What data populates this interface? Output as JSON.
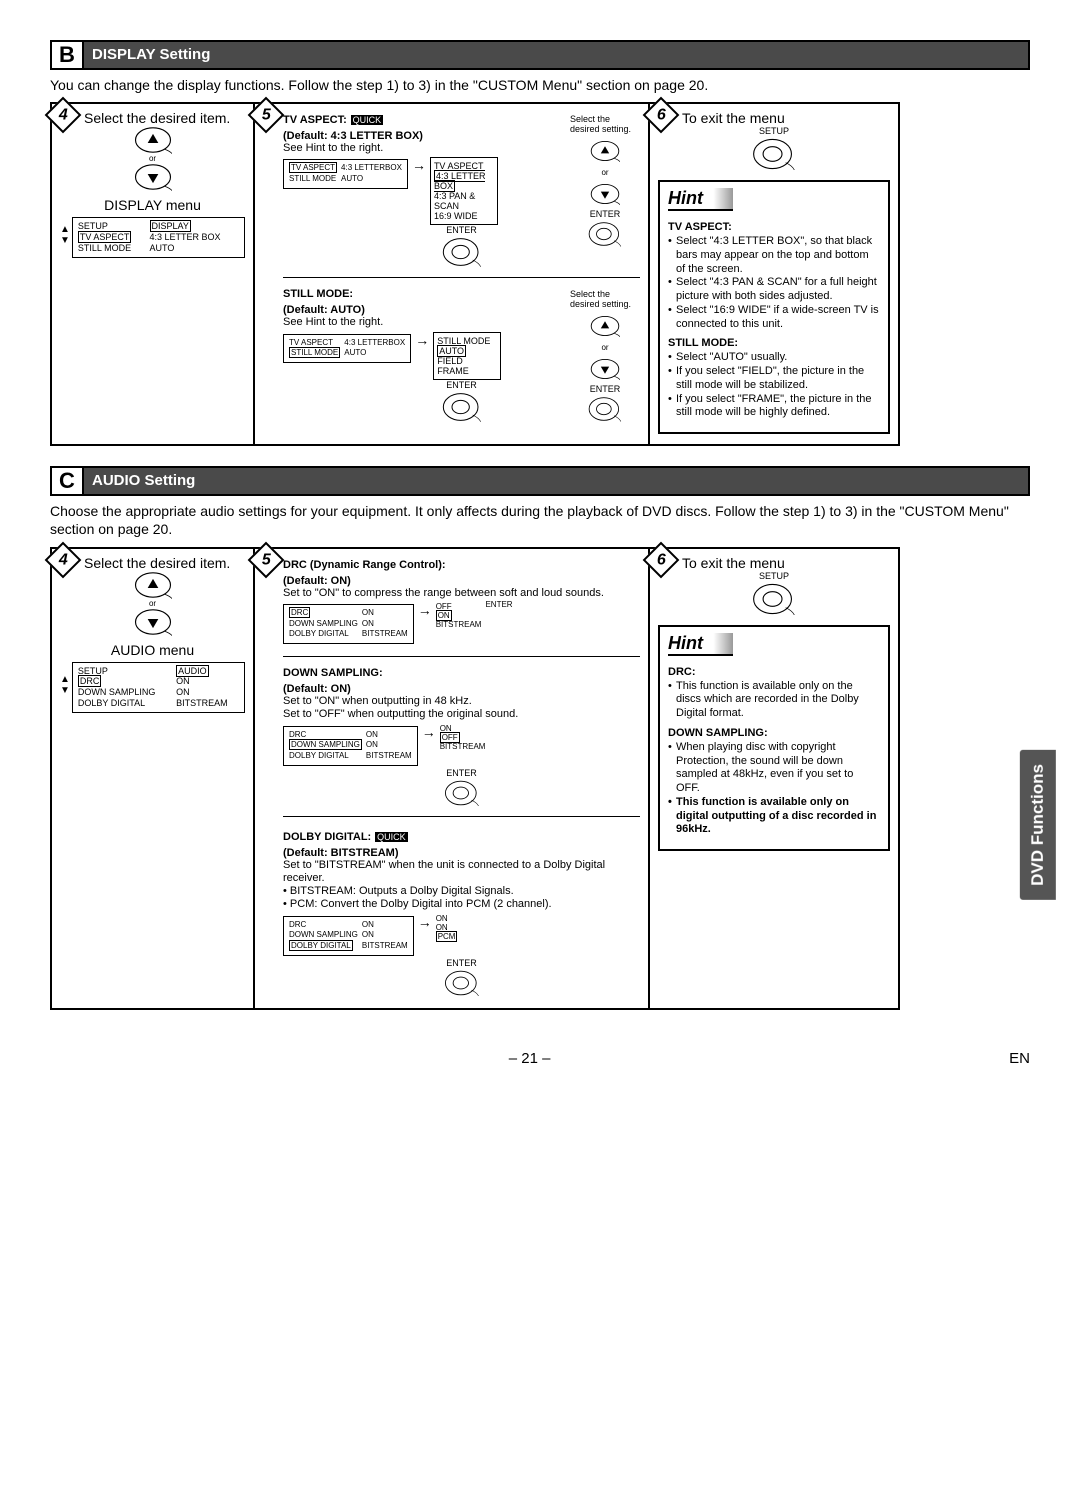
{
  "page_number": "– 21 –",
  "lang_code": "EN",
  "side_tab": "DVD Functions",
  "sectionB": {
    "letter": "B",
    "title": "DISPLAY Setting",
    "intro": "You can change the display functions. Follow the step 1) to 3) in the \"CUSTOM Menu\" section on page 20.",
    "step4": {
      "num": "4",
      "inst": "Select the desired item.",
      "or": "or",
      "menu_title": "DISPLAY menu",
      "screen": {
        "hdr_l": "SETUP",
        "hdr_r": "DISPLAY",
        "r1l": "TV ASPECT",
        "r1r": "4:3 LETTER BOX",
        "r2l": "STILL MODE",
        "r2r": "AUTO"
      }
    },
    "step5": {
      "num": "5",
      "tv": {
        "head": "TV ASPECT:",
        "quick": "QUICK",
        "def": "(Default: 4:3 LETTER BOX)",
        "see": "See Hint to the right.",
        "screen": {
          "r1l": "TV ASPECT",
          "r1r": "4:3 LETTERBOX",
          "r2l": "STILL MODE",
          "r2r": "AUTO"
        },
        "options": {
          "hdr": "TV ASPECT",
          "o1": "4:3 LETTER BOX",
          "o2": "4:3 PAN & SCAN",
          "o3": "16:9 WIDE"
        }
      },
      "still": {
        "head": "STILL MODE:",
        "def": "(Default: AUTO)",
        "see": "See Hint to the right.",
        "screen": {
          "r1l": "TV ASPECT",
          "r1r": "4:3 LETTERBOX",
          "r2l": "STILL MODE",
          "r2r": "AUTO"
        },
        "options": {
          "hdr": "STILL MODE",
          "o1": "AUTO",
          "o2": "FIELD",
          "o3": "FRAME"
        }
      },
      "sel": "Select the desired setting.",
      "enter": "ENTER",
      "or": "or"
    },
    "step6": {
      "num": "6",
      "inst": "To exit the menu",
      "setup": "SETUP",
      "hint_hdr": "Hint",
      "tv_hdr": "TV ASPECT:",
      "tv_items": [
        "Select \"4:3 LETTER BOX\", so that black bars may appear on the top and bottom of the screen.",
        "Select \"4:3 PAN & SCAN\" for a full height picture with both sides adjusted.",
        "Select \"16:9 WIDE\" if a wide-screen TV is connected to this unit."
      ],
      "still_hdr": "STILL MODE:",
      "still_items": [
        "Select \"AUTO\" usually.",
        "If you select \"FIELD\", the picture in the still mode will be stabilized.",
        "If you select \"FRAME\", the picture in the still mode will be highly defined."
      ]
    }
  },
  "sectionC": {
    "letter": "C",
    "title": "AUDIO Setting",
    "intro": "Choose the appropriate audio settings for your equipment. It only affects during the playback of DVD discs. Follow the step 1) to 3) in the \"CUSTOM Menu\" section on page 20.",
    "step4": {
      "num": "4",
      "inst": "Select the desired item.",
      "or": "or",
      "menu_title": "AUDIO menu",
      "screen": {
        "hdr_l": "SETUP",
        "hdr_r": "AUDIO",
        "r1l": "DRC",
        "r1r": "ON",
        "r2l": "DOWN SAMPLING",
        "r2r": "ON",
        "r3l": "DOLBY DIGITAL",
        "r3r": "BITSTREAM"
      }
    },
    "step5": {
      "num": "5",
      "drc": {
        "head": "DRC (Dynamic Range Control):",
        "def": "(Default: ON)",
        "desc": "Set to \"ON\" to compress the range between soft and loud sounds.",
        "screen": {
          "r1l": "DRC",
          "r1r": "ON",
          "r2l": "DOWN SAMPLING",
          "r2r": "ON",
          "r3l": "DOLBY DIGITAL",
          "r3r": "BITSTREAM"
        },
        "opts": {
          "o1": "OFF",
          "o2": "ON",
          "o3": "BITSTREAM"
        }
      },
      "ds": {
        "head": "DOWN SAMPLING:",
        "def": "(Default: ON)",
        "d1": "Set to \"ON\" when outputting in 48 kHz.",
        "d2": "Set to \"OFF\" when outputting the original sound.",
        "screen": {
          "r1l": "DRC",
          "r1r": "ON",
          "r2l": "DOWN SAMPLING",
          "r2r": "ON",
          "r3l": "DOLBY DIGITAL",
          "r3r": "BITSTREAM"
        },
        "opts": {
          "o1": "ON",
          "o2": "OFF",
          "o3": "BITSTREAM"
        }
      },
      "dd": {
        "head": "DOLBY DIGITAL:",
        "quick": "QUICK",
        "def": "(Default: BITSTREAM)",
        "d1": "Set to \"BITSTREAM\" when the unit is connected to a Dolby Digital receiver.",
        "d2": "• BITSTREAM: Outputs a Dolby Digital Signals.",
        "d3": "• PCM: Convert the Dolby Digital into PCM (2 channel).",
        "screen": {
          "r1l": "DRC",
          "r1r": "ON",
          "r2l": "DOWN SAMPLING",
          "r2r": "ON",
          "r3l": "DOLBY DIGITAL",
          "r3r": "BITSTREAM"
        },
        "opts": {
          "o1": "ON",
          "o2": "ON",
          "o3": "PCM"
        }
      },
      "enter": "ENTER"
    },
    "step6": {
      "num": "6",
      "inst": "To exit the menu",
      "setup": "SETUP",
      "hint_hdr": "Hint",
      "drc_hdr": "DRC:",
      "drc_items": [
        "This function is available only on the discs which are recorded in the Dolby Digital format."
      ],
      "ds_hdr": "DOWN SAMPLING:",
      "ds_items": [
        "When playing disc with copyright Protection, the sound will be down sampled at 48kHz, even if you set to OFF."
      ],
      "ds_bold": "This function is available only on digital outputting of a disc recorded in 96kHz."
    }
  }
}
